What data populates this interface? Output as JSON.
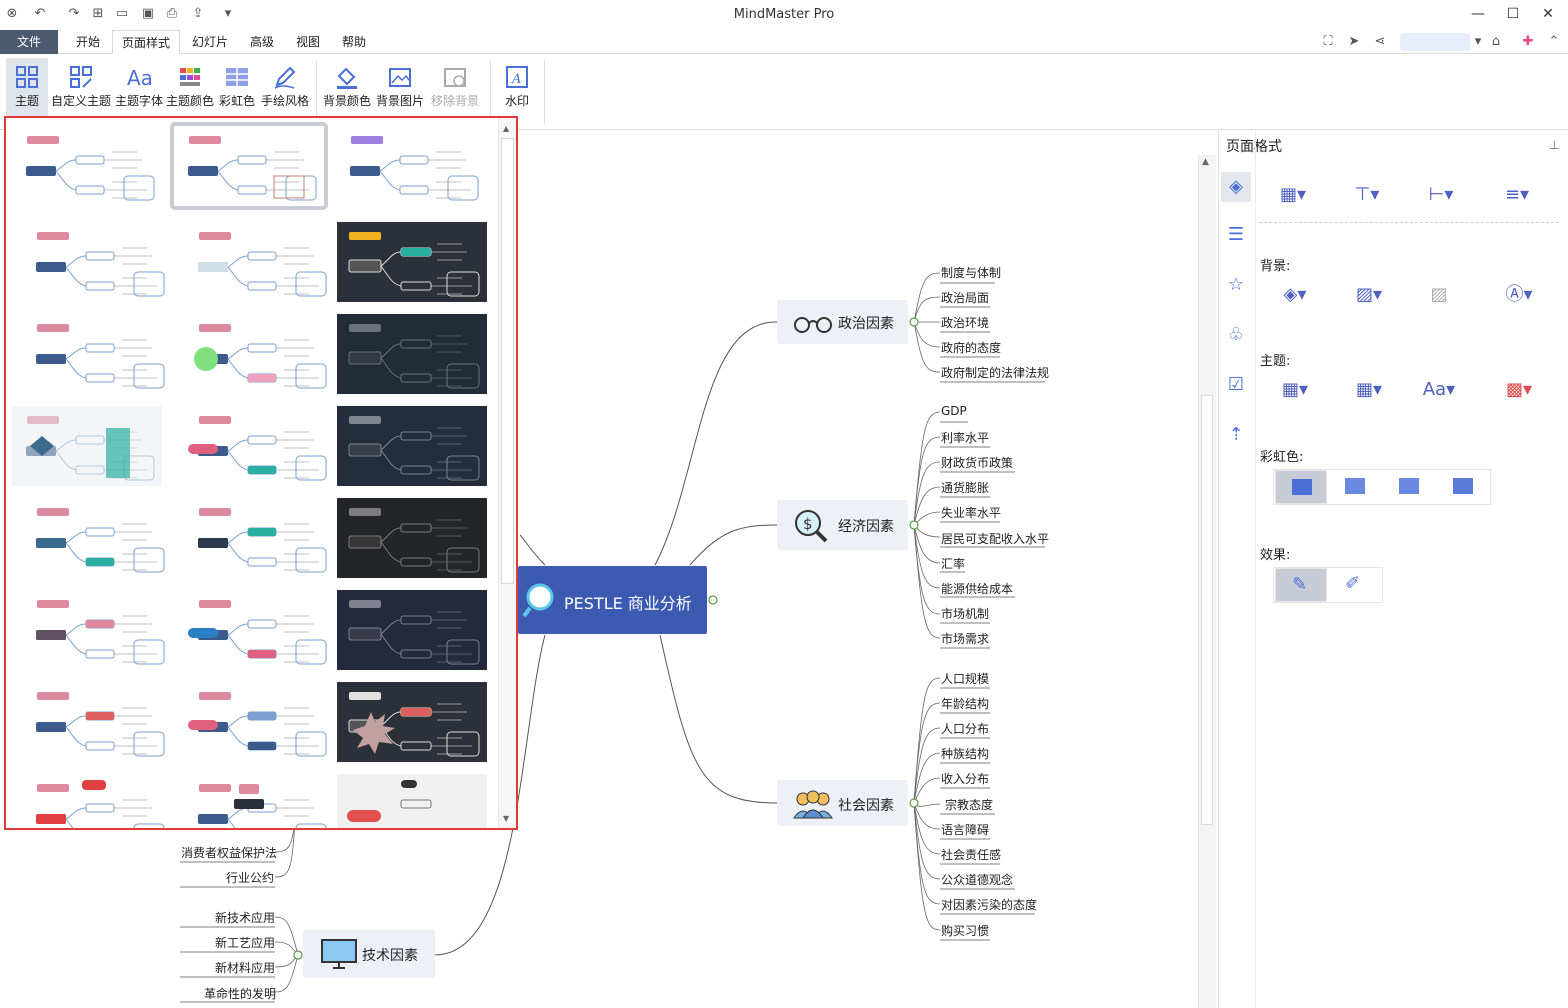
{
  "app": {
    "title": "MindMaster Pro"
  },
  "menu": {
    "file": "文件",
    "start": "开始",
    "page_style": "页面样式",
    "slideshow": "幻灯片",
    "advanced": "高级",
    "view": "视图",
    "help": "帮助"
  },
  "ribbon": {
    "theme": "主题",
    "custom_theme": "自定义主题",
    "theme_font": "主题字体",
    "theme_color": "主题颜色",
    "rainbow": "彩虹色",
    "hand_drawn": "手绘风格",
    "bg_color": "背景颜色",
    "bg_image": "背景图片",
    "remove_bg": "移除背景",
    "watermark": "水印"
  },
  "panel": {
    "title": "页面格式",
    "background_label": "背景:",
    "theme_label": "主题:",
    "rainbow_label": "彩虹色:",
    "effect_label": "效果:"
  },
  "mindmap": {
    "central": "PESTLE 商业分析",
    "political": {
      "title": "政治因素",
      "items": [
        "制度与体制",
        "政治局面",
        "政治环境",
        "政府的态度",
        "政府制定的法律法规"
      ]
    },
    "economic": {
      "title": "经济因素",
      "items": [
        "GDP",
        "利率水平",
        "财政货币政策",
        "通货膨胀",
        "失业率水平",
        "居民可支配收入水平",
        "汇率",
        "能源供给成本",
        "市场机制",
        "市场需求"
      ]
    },
    "social": {
      "title": "社会因素",
      "items": [
        "人口规模",
        "年龄结构",
        "人口分布",
        "种族结构",
        "收入分布",
        "宗教态度",
        "语言障碍",
        "社会责任感",
        "公众道德观念",
        "对因素污染的态度",
        "购买习惯"
      ]
    },
    "tech": {
      "title": "技术因素",
      "items": [
        "新技术应用",
        "新工艺应用",
        "新材料应用",
        "革命性的发明"
      ]
    },
    "legal_visible": [
      "消费者权益保护法",
      "行业公约"
    ]
  },
  "colors": {
    "accent": "#3c5ab2",
    "selection_border": "#e03a3a",
    "menu_file_bg": "#4b5a6e"
  }
}
